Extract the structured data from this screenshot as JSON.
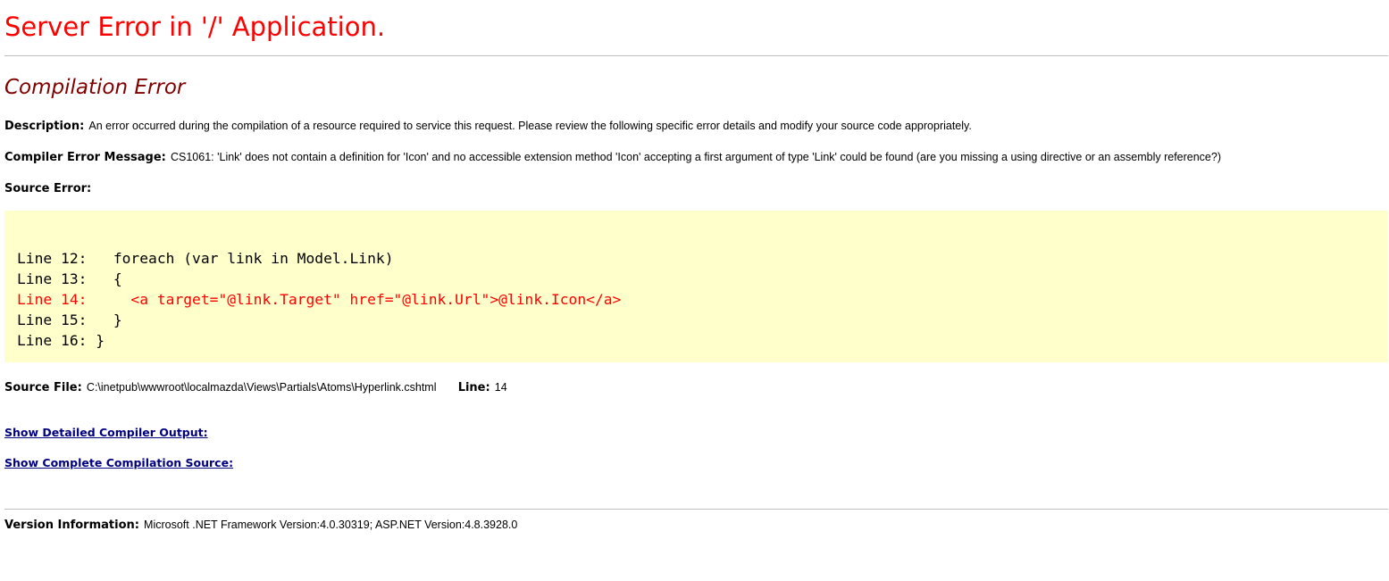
{
  "header": {
    "title": "Server Error in '/' Application."
  },
  "error": {
    "title": "Compilation Error",
    "description_label": "Description:",
    "description_text": "An error occurred during the compilation of a resource required to service this request. Please review the following specific error details and modify your source code appropriately.",
    "compiler_message_label": "Compiler Error Message:",
    "compiler_message_text": "CS1061: 'Link' does not contain a definition for 'Icon' and no accessible extension method 'Icon' accepting a first argument of type 'Link' could be found (are you missing a using directive or an assembly reference?)",
    "source_error_label": "Source Error:"
  },
  "source_code": {
    "lines": [
      {
        "text": "Line 12:   foreach (var link in Model.Link)",
        "is_error": false
      },
      {
        "text": "Line 13:   {",
        "is_error": false
      },
      {
        "text": "Line 14:     <a target=\"@link.Target\" href=\"@link.Url\">@link.Icon</a>",
        "is_error": true
      },
      {
        "text": "Line 15:   }",
        "is_error": false
      },
      {
        "text": "Line 16: }",
        "is_error": false
      }
    ]
  },
  "source_file": {
    "label": "Source File:",
    "path": "C:\\inetpub\\wwwroot\\localmazda\\Views\\Partials\\Atoms\\Hyperlink.cshtml",
    "line_label": "Line:",
    "line_value": "14"
  },
  "links": {
    "detailed_output": "Show Detailed Compiler Output:",
    "complete_source": "Show Complete Compilation Source:"
  },
  "version": {
    "label": "Version Information:",
    "text": "Microsoft .NET Framework Version:4.0.30319; ASP.NET Version:4.8.3928.0"
  },
  "colors": {
    "title": "#ff0000",
    "error_title": "#800000",
    "code_background": "#ffffcc",
    "code_error_line": "#ff0000",
    "link": "#000080",
    "rule": "#c0c0c0"
  }
}
